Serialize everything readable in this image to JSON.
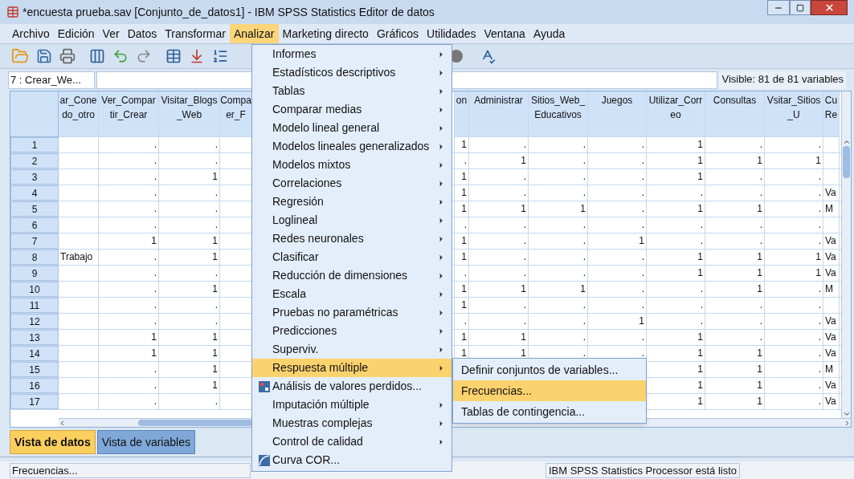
{
  "window": {
    "title": "*encuesta prueba.sav [Conjunto_de_datos1] - IBM SPSS Statistics Editor de datos"
  },
  "menubar": [
    {
      "label": "Archivo",
      "selected": false
    },
    {
      "label": "Edición",
      "selected": false
    },
    {
      "label": "Ver",
      "selected": false
    },
    {
      "label": "Datos",
      "selected": false
    },
    {
      "label": "Transformar",
      "selected": false
    },
    {
      "label": "Analizar",
      "selected": true
    },
    {
      "label": "Marketing directo",
      "selected": false
    },
    {
      "label": "Gráficos",
      "selected": false
    },
    {
      "label": "Utilidades",
      "selected": false
    },
    {
      "label": "Ventana",
      "selected": false
    },
    {
      "label": "Ayuda",
      "selected": false
    }
  ],
  "cell_reference": "7 : Crear_We...",
  "visible_count": "Visible: 81 de 81 variables",
  "table": {
    "columns": [
      {
        "line_1": "ar_Cone",
        "line_2": "do_otro"
      },
      {
        "line_1": "Ver_Compar",
        "line_2": "tir_Crear"
      },
      {
        "line_1": "Visitar_Blogs",
        "line_2": "_Web"
      },
      {
        "line_1": "Compa",
        "line_2": "er_F"
      },
      {
        "line_1": "on"
      },
      {
        "line_1": "Administrar"
      },
      {
        "line_1": "Sitios_Web_",
        "line_2": "Educativos"
      },
      {
        "line_1": "Juegos"
      },
      {
        "line_1": "Utilizar_Corr",
        "line_2": "eo"
      },
      {
        "line_1": "Consultas"
      },
      {
        "line_1": "Vsitar_Sitios",
        "line_2": "_U"
      },
      {
        "line_1": "Cu",
        "line_2": "Re"
      }
    ],
    "rows": [
      {
        "number": "1",
        "cells": [
          null,
          ".",
          ".",
          null,
          "1",
          ".",
          ".",
          ".",
          "1",
          ".",
          ".",
          null
        ]
      },
      {
        "number": "2",
        "cells": [
          null,
          ".",
          ".",
          null,
          ".",
          "1",
          ".",
          ".",
          "1",
          "1",
          "1",
          null
        ]
      },
      {
        "number": "3",
        "cells": [
          null,
          ".",
          "1",
          null,
          "1",
          ".",
          ".",
          ".",
          "1",
          ".",
          ".",
          null
        ]
      },
      {
        "number": "4",
        "cells": [
          null,
          ".",
          ".",
          null,
          "1",
          ".",
          ".",
          ".",
          ".",
          ".",
          ".",
          "Va"
        ]
      },
      {
        "number": "5",
        "cells": [
          null,
          ".",
          ".",
          null,
          "1",
          "1",
          "1",
          ".",
          "1",
          "1",
          ".",
          "M"
        ]
      },
      {
        "number": "6",
        "cells": [
          null,
          ".",
          ".",
          null,
          ".",
          ".",
          ".",
          ".",
          ".",
          ".",
          ".",
          null
        ]
      },
      {
        "number": "7",
        "cells": [
          null,
          "1",
          "1",
          null,
          "1",
          ".",
          ".",
          "1",
          ".",
          ".",
          ".",
          "Va"
        ]
      },
      {
        "number": "8",
        "cells": [
          "Trabajo",
          ".",
          "1",
          null,
          "1",
          ".",
          ".",
          ".",
          "1",
          "1",
          "1",
          "Va"
        ]
      },
      {
        "number": "9",
        "cells": [
          null,
          ".",
          ".",
          null,
          ".",
          ".",
          ".",
          ".",
          "1",
          "1",
          "1",
          "Va"
        ]
      },
      {
        "number": "10",
        "cells": [
          null,
          ".",
          "1",
          null,
          "1",
          "1",
          "1",
          ".",
          ".",
          "1",
          ".",
          "M"
        ]
      },
      {
        "number": "11",
        "cells": [
          null,
          ".",
          ".",
          null,
          "1",
          ".",
          ".",
          ".",
          ".",
          ".",
          ".",
          null
        ]
      },
      {
        "number": "12",
        "cells": [
          null,
          ".",
          ".",
          null,
          ".",
          ".",
          ".",
          "1",
          ".",
          ".",
          ".",
          "Va"
        ]
      },
      {
        "number": "13",
        "cells": [
          null,
          "1",
          "1",
          null,
          "1",
          "1",
          ".",
          ".",
          "1",
          ".",
          ".",
          "Va"
        ]
      },
      {
        "number": "14",
        "cells": [
          null,
          "1",
          "1",
          null,
          "1",
          "1",
          ".",
          ".",
          "1",
          "1",
          ".",
          "Va"
        ]
      },
      {
        "number": "15",
        "cells": [
          null,
          ".",
          "1",
          null,
          null,
          null,
          null,
          null,
          "1",
          "1",
          ".",
          "M"
        ]
      },
      {
        "number": "16",
        "cells": [
          null,
          ".",
          "1",
          null,
          null,
          null,
          null,
          null,
          "1",
          "1",
          ".",
          "Va"
        ]
      },
      {
        "number": "17",
        "cells": [
          null,
          ".",
          ".",
          null,
          null,
          null,
          null,
          null,
          "1",
          "1",
          ".",
          "Va"
        ]
      }
    ]
  },
  "analyze_menu": {
    "items": [
      {
        "label": "Informes",
        "kind": "submenu",
        "selected": false
      },
      {
        "label": "Estadísticos descriptivos",
        "kind": "submenu",
        "selected": false
      },
      {
        "label": "Tablas",
        "kind": "submenu",
        "selected": false
      },
      {
        "label": "Comparar medias",
        "kind": "submenu",
        "selected": false
      },
      {
        "label": "Modelo lineal general",
        "kind": "submenu",
        "selected": false
      },
      {
        "label": "Modelos lineales generalizados",
        "kind": "submenu",
        "selected": false
      },
      {
        "label": "Modelos mixtos",
        "kind": "submenu",
        "selected": false
      },
      {
        "label": "Correlaciones",
        "kind": "submenu",
        "selected": false
      },
      {
        "label": "Regresión",
        "kind": "submenu",
        "selected": false
      },
      {
        "label": "Loglineal",
        "kind": "submenu",
        "selected": false
      },
      {
        "label": "Redes neuronales",
        "kind": "submenu",
        "selected": false
      },
      {
        "label": "Clasificar",
        "kind": "submenu",
        "selected": false
      },
      {
        "label": "Reducción de dimensiones",
        "kind": "submenu",
        "selected": false
      },
      {
        "label": "Escala",
        "kind": "submenu",
        "selected": false
      },
      {
        "label": "Pruebas no paramétricas",
        "kind": "submenu",
        "selected": false
      },
      {
        "label": "Predicciones",
        "kind": "submenu",
        "selected": false
      },
      {
        "label": "Superviv.",
        "kind": "submenu",
        "selected": false
      },
      {
        "label": "Respuesta múltiple",
        "kind": "submenu",
        "selected": true
      },
      {
        "label": "Análisis de valores perdidos...",
        "kind": "grid",
        "selected": false
      },
      {
        "label": "Imputación múltiple",
        "kind": "submenu",
        "selected": false
      },
      {
        "label": "Muestras complejas",
        "kind": "submenu",
        "selected": false
      },
      {
        "label": "Control de calidad",
        "kind": "submenu",
        "selected": false
      },
      {
        "label": "Curva COR...",
        "kind": "curve",
        "selected": false
      }
    ]
  },
  "submenu": {
    "items": [
      {
        "label": "Definir conjuntos de variables...",
        "selected": false
      },
      {
        "label": "Frecuencias...",
        "selected": true
      },
      {
        "label": "Tablas de contingencia...",
        "selected": false
      }
    ]
  },
  "view_tabs": [
    {
      "label": "Vista de datos",
      "selected": true
    },
    {
      "label": "Vista de variables",
      "selected": false
    }
  ],
  "status_bar": {
    "message": "Frecuencias...",
    "processor": "IBM SPSS Statistics Processor está listo"
  }
}
